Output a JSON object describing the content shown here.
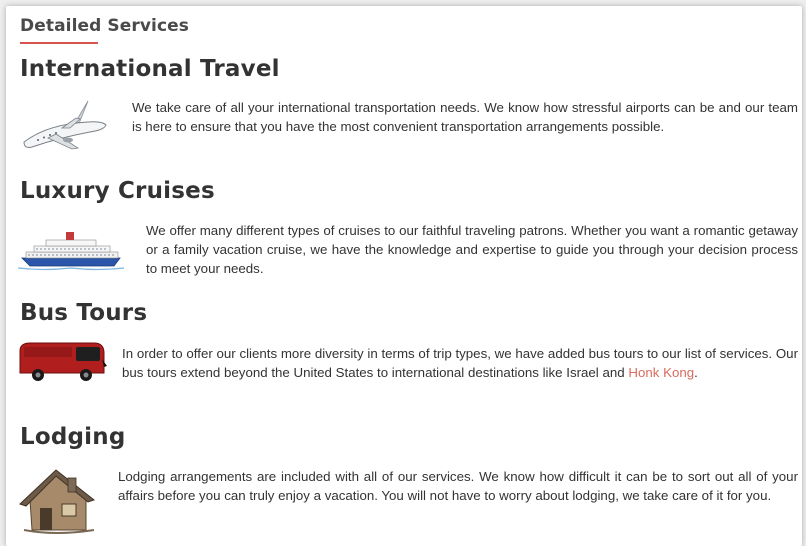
{
  "page": {
    "section_heading": "Detailed Services",
    "accent_color": "#d9534f"
  },
  "services": [
    {
      "title": "International Travel",
      "icon": "airplane-icon",
      "text": "We take care of all your international transportation needs.  We know how stressful airports can be and our team is here to ensure that you have the most convenient transportation arrangements possible."
    },
    {
      "title": "Luxury Cruises",
      "icon": "cruise-ship-icon",
      "text": "We offer many different types of cruises to our faithful traveling patrons.  Whether you want a romantic getaway or a family vacation cruise, we have the knowledge and expertise to guide you through your decision process to meet your needs."
    },
    {
      "title": "Bus Tours",
      "icon": "bus-icon",
      "text_before_link": "In order to offer our clients more diversity in terms of trip types, we have added bus tours to our list of services.  Our bus tours extend beyond the United States to international destinations like Israel and ",
      "link_text": "Honk Kong",
      "text_after_link": "."
    },
    {
      "title": "Lodging",
      "icon": "house-icon",
      "text": "Lodging arrangements are included with all of our services.  We know how difficult it can be to sort out all of your affairs before you can truly enjoy a vacation.  You will not have to worry about lodging, we take care of it for you."
    }
  ]
}
